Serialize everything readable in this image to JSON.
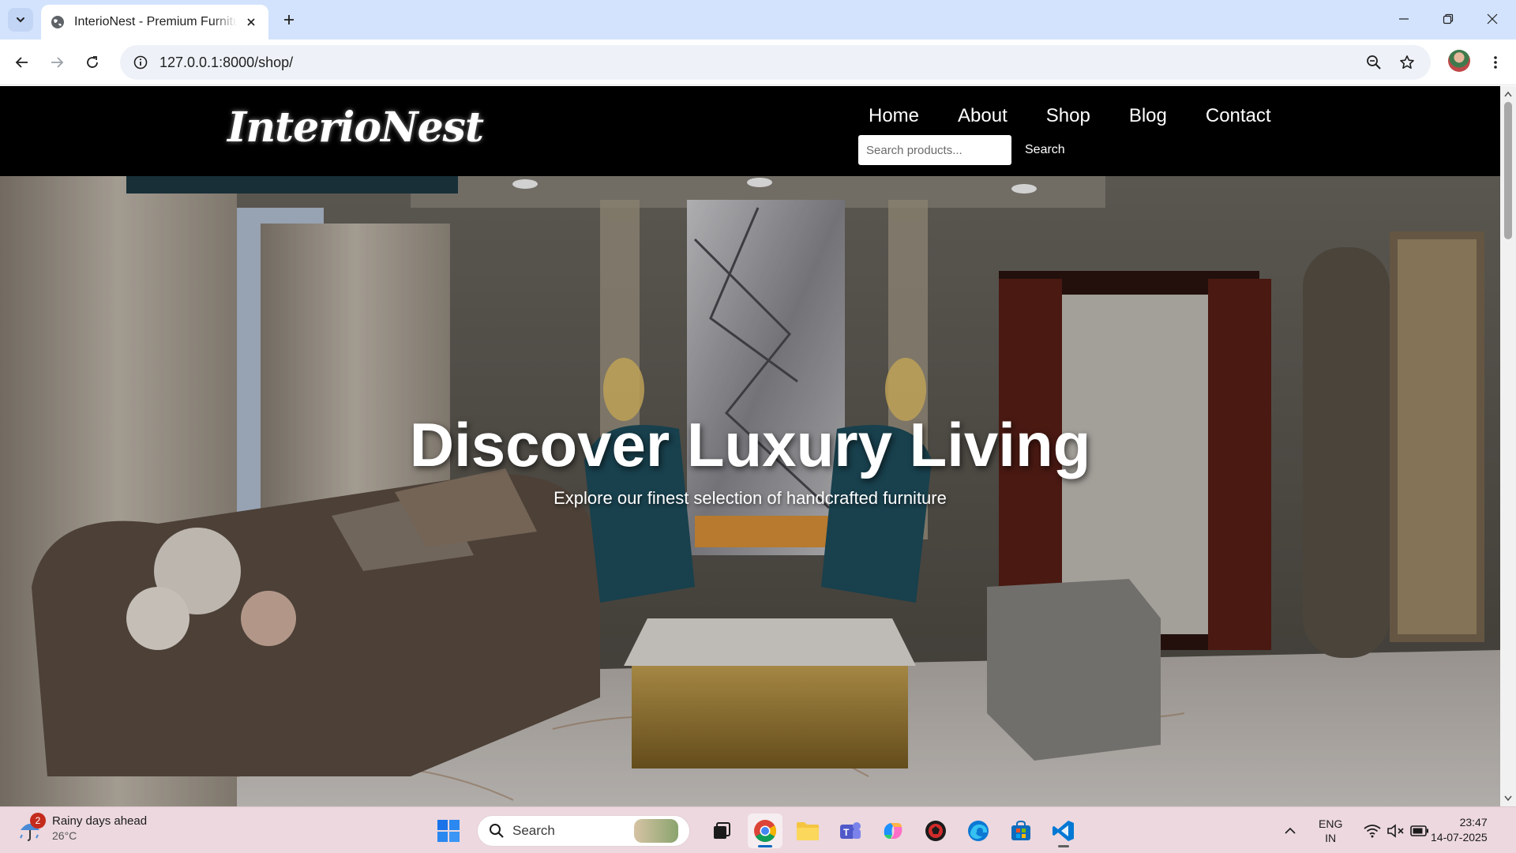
{
  "browser": {
    "tab_title": "InterioNest - Premium Furniture",
    "url": "127.0.0.1:8000/shop/"
  },
  "site": {
    "logo": "InterioNest",
    "nav": [
      {
        "label": "Home"
      },
      {
        "label": "About"
      },
      {
        "label": "Shop"
      },
      {
        "label": "Blog"
      },
      {
        "label": "Contact"
      }
    ],
    "search_placeholder": "Search products...",
    "search_button": "Search"
  },
  "hero": {
    "title": "Discover Luxury Living",
    "subtitle": "Explore our finest selection of handcrafted furniture"
  },
  "taskbar": {
    "weather_title": "Rainy days ahead",
    "weather_temp": "26°C",
    "weather_badge": "2",
    "search_label": "Search",
    "language_top": "ENG",
    "language_bottom": "IN",
    "time": "23:47",
    "date": "14-07-2025"
  }
}
